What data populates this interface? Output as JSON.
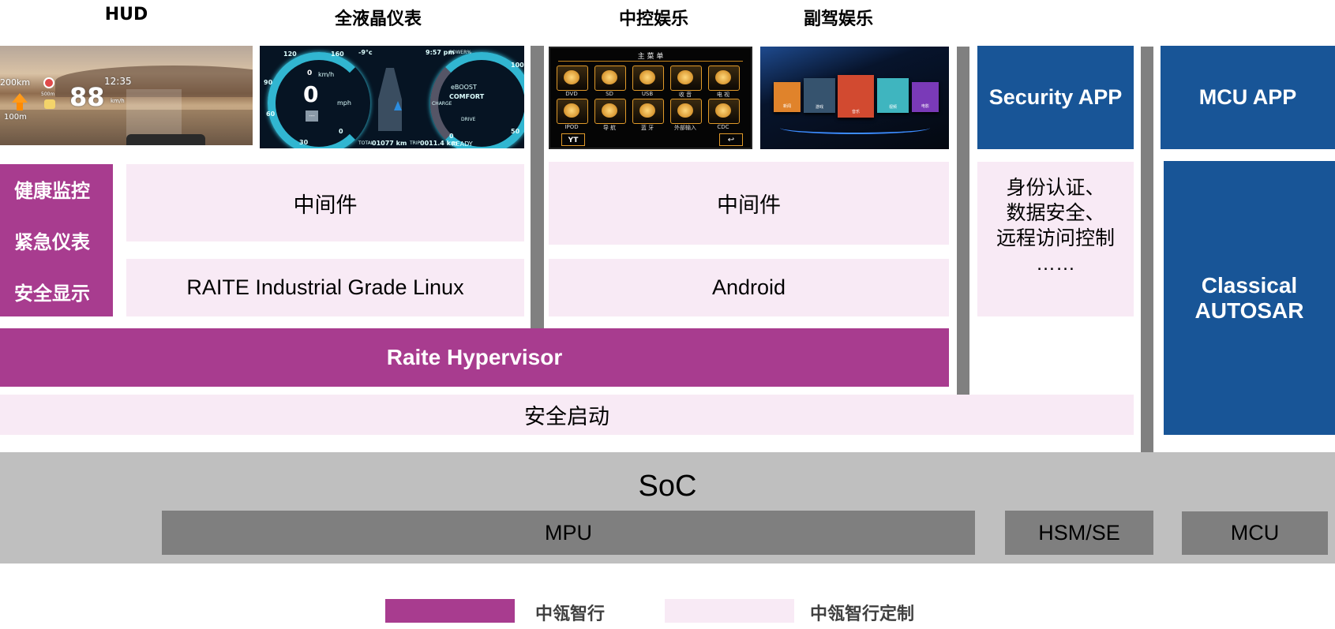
{
  "columns": {
    "hud": "HUD",
    "cluster": "全液晶仪表",
    "ivi": "中控娱乐",
    "passenger": "副驾娱乐"
  },
  "hud_screen": {
    "distance": "200km",
    "turn_distance": "100m",
    "time": "12:35",
    "speed": "88",
    "speed_unit": "km/h",
    "car_distance": "500m"
  },
  "cluster_screen": {
    "speed_kmh": "0",
    "speed_kmh_unit": "km/h",
    "speed_mph": "0",
    "speed_mph_unit": "mph",
    "gear": "---",
    "temp": "-9°c",
    "clock": "9:57 pm",
    "mode": "COMFORT",
    "boost": "eBOOST",
    "status": "READY",
    "total_label": "TOTAL",
    "total": "01077 km",
    "trip_label": "TRIP",
    "trip": "0011.4 km",
    "left_ticks": [
      "120",
      "160",
      "90",
      "60",
      "30",
      "0"
    ],
    "right_ticks": [
      "100",
      "50",
      "0"
    ],
    "power_label": "POWER%",
    "charge_label": "CHARGE",
    "drive_label": "DRIVE"
  },
  "ivi_screen": {
    "menu_title": "主 菜 单",
    "items": [
      "DVD",
      "SD",
      "USB",
      "收 音",
      "电 视",
      "IPOD",
      "导 航",
      "蓝 牙",
      "外部输入",
      "CDC"
    ],
    "settings_button": "YT",
    "back_button": "↩"
  },
  "passenger_screen": {
    "tiles": [
      "新闻",
      "游戏",
      "音乐",
      "视频",
      "电影"
    ]
  },
  "side_functions": [
    "健康监控",
    "紧急仪表",
    "安全显示"
  ],
  "linux_stack": {
    "middleware": "中间件",
    "os": "RAITE Industrial Grade Linux"
  },
  "android_stack": {
    "middleware": "中间件",
    "os": "Android"
  },
  "security": {
    "app": "Security APP",
    "features": [
      "身份认证、",
      "数据安全、",
      "远程访问控制",
      "……"
    ]
  },
  "mcu_side": {
    "app": "MCU APP",
    "os_line1": "Classical",
    "os_line2": "AUTOSAR"
  },
  "hypervisor": "Raite Hypervisor",
  "secure_boot": "安全启动",
  "hardware": {
    "soc": "SoC",
    "mpu": "MPU",
    "hsm": "HSM/SE",
    "mcu": "MCU"
  },
  "legend": [
    {
      "label": "中瓴智行",
      "color": "#a83c8f"
    },
    {
      "label": "中瓴智行定制",
      "color": "#f8eaf5"
    }
  ],
  "colors": {
    "purple": "#a83c8f",
    "pink": "#f8eaf5",
    "blue": "#185597",
    "divider": "#808080",
    "soc": "#bfbfbf",
    "chip": "#7f7f7f"
  }
}
